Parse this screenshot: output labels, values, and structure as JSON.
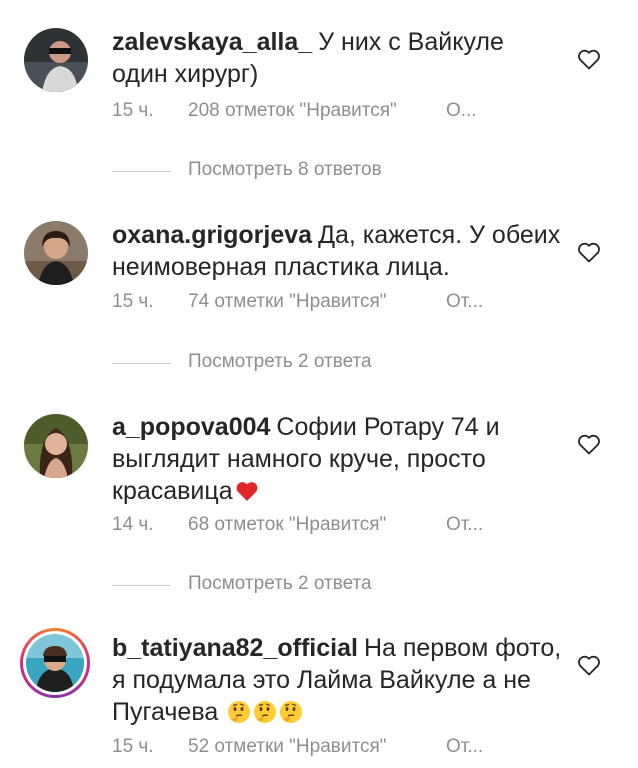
{
  "comments": [
    {
      "username": "zalevskaya_alla_",
      "text": "У них с Вайкуле один хирург)",
      "emoji": "",
      "time": "15 ч.",
      "likes": "208 отметок \"Нравится\"",
      "reply": "О...",
      "view_replies": "Посмотреть 8 ответов"
    },
    {
      "username": "oxana.grigorjeva",
      "text": "Да, кажется. У обеих неимоверная пластика лица.",
      "emoji": "",
      "time": "15 ч.",
      "likes": "74 отметки \"Нравится\"",
      "reply": "От...",
      "view_replies": "Посмотреть 2 ответа"
    },
    {
      "username": "a_popova004",
      "text": "Софии Ротару 74 и выглядит намного круче, просто красавица",
      "emoji": "❤️",
      "time": "14 ч.",
      "likes": "68 отметок \"Нравится\"",
      "reply": "От...",
      "view_replies": "Посмотреть 2 ответа"
    },
    {
      "username": "b_tatiyana82_official",
      "text": "На первом фото, я подумала это Лайма Вайкуле а не Пугачева",
      "emoji": "🤔🤔🤔",
      "time": "15 ч.",
      "likes": "52 отметки \"Нравится\"",
      "reply": "От...",
      "view_replies": ""
    }
  ],
  "colors": {
    "text": "#262626",
    "muted": "#8e8e8e",
    "heart_red": "#e0262b",
    "story_ring_start": "#f58529",
    "story_ring_end": "#dd2a7b"
  },
  "icons": {
    "like": "heart-outline-icon",
    "emoji_heart": "red-heart-emoji",
    "emoji_thinking": "thinking-face-emoji"
  }
}
